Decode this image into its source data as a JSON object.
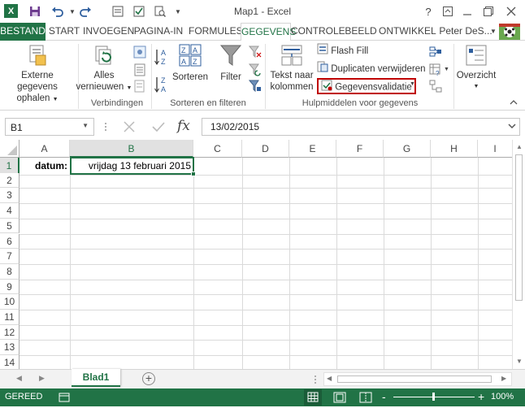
{
  "window": {
    "title": "Map1 - Excel",
    "help": "?",
    "undo_icon": "undo-icon",
    "save_icon": "save-icon"
  },
  "tabs": [
    "BESTAND",
    "START",
    "INVOEGEN",
    "PAGINA-IN",
    "FORMULES",
    "GEGEVENS",
    "CONTROLE",
    "BEELD",
    "ONTWIKKEL"
  ],
  "user": "Peter DeS...",
  "ribbon": {
    "external_line1": "Externe gegevens",
    "external_line2": "ophalen",
    "refresh_line1": "Alles",
    "refresh_line2": "vernieuwen",
    "group_connections": "Verbindingen",
    "sort": "Sorteren",
    "filter": "Filter",
    "group_sort": "Sorteren en filteren",
    "text_line1": "Tekst naar",
    "text_line2": "kolommen",
    "flash_fill": "Flash Fill",
    "remove_duplicates": "Duplicaten verwijderen",
    "data_validation": "Gegevensvalidatie",
    "group_tools": "Hulpmiddelen voor gegevens",
    "outline": "Overzicht",
    "accent": "#217346",
    "highlight": "#c00000"
  },
  "formula_bar": {
    "name_box": "B1",
    "fx": "fx",
    "value": "13/02/2015"
  },
  "grid": {
    "columns": [
      "A",
      "B",
      "C",
      "D",
      "E",
      "F",
      "G",
      "H",
      "I"
    ],
    "rows": [
      "1",
      "2",
      "3",
      "4",
      "5",
      "6",
      "7",
      "8",
      "9",
      "10",
      "11",
      "12",
      "13",
      "14"
    ],
    "cell_a1": "datum:",
    "cell_b1": "vrijdag 13 februari 2015"
  },
  "sheets": {
    "active": "Blad1",
    "add": "+"
  },
  "status": {
    "ready": "GEREED",
    "zoom": "100%",
    "minus": "-",
    "plus": "+"
  }
}
